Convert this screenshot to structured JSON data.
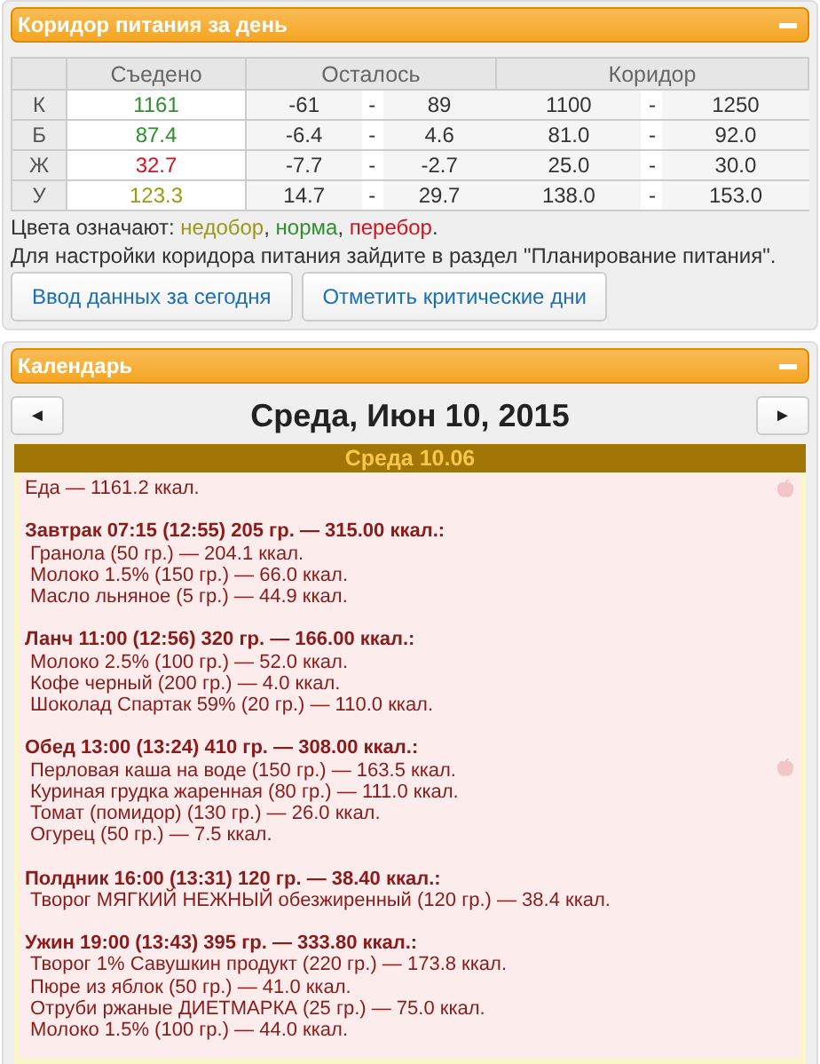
{
  "corridor_panel": {
    "title": "Коридор питания за день",
    "table": {
      "columns": [
        "Съедено",
        "Осталось",
        "Коридор"
      ],
      "rows": [
        {
          "label": "К",
          "eaten": "1161",
          "color": "#2f8f2f",
          "remaining": [
            "-61",
            "-",
            "89"
          ],
          "corridor": [
            "1100",
            "-",
            "1250"
          ]
        },
        {
          "label": "Б",
          "eaten": "87.4",
          "color": "#2f8f2f",
          "remaining": [
            "-6.4",
            "-",
            "4.6"
          ],
          "corridor": [
            "81.0",
            "-",
            "92.0"
          ]
        },
        {
          "label": "Ж",
          "eaten": "32.7",
          "color": "#d8121e",
          "remaining": [
            "-7.7",
            "-",
            "-2.7"
          ],
          "corridor": [
            "25.0",
            "-",
            "30.0"
          ]
        },
        {
          "label": "У",
          "eaten": "123.3",
          "color": "#9a9a16",
          "remaining": [
            "14.7",
            "-",
            "29.7"
          ],
          "corridor": [
            "138.0",
            "-",
            "153.0"
          ]
        }
      ]
    },
    "legend": [
      {
        "text": "Цвета означают: "
      },
      {
        "text": "недобор",
        "color": "#9a9a16"
      },
      {
        "text": ", "
      },
      {
        "text": "норма",
        "color": "#2f8f2f"
      },
      {
        "text": ", "
      },
      {
        "text": "перебор",
        "color": "#d8121e"
      },
      {
        "text": "."
      }
    ],
    "note": "Для настройки коридора питания зайдите в раздел \"Планирование питания\".",
    "buttons": [
      "Ввод данных за сегодня",
      "Отметить критические дни"
    ]
  },
  "calendar_panel": {
    "title": "Календарь",
    "prev": "◄",
    "next": "►",
    "date": "Среда, Июн 10, 2015",
    "day": {
      "title": "Среда 10.06",
      "total": "Еда — 1161.2 ккал.",
      "meals": [
        {
          "heading": "Завтрак 07:15 (12:55) 205 гр. — 315.00 ккал.:",
          "items": [
            "Гранола (50 гр.) — 204.1 ккал.",
            "Молоко 1.5% (150 гр.) — 66.0 ккал.",
            "Масло льняное (5 гр.) — 44.9 ккал."
          ]
        },
        {
          "heading": "Ланч 11:00 (12:56) 320 гр. — 166.00 ккал.:",
          "items": [
            "Молоко 2.5% (100 гр.) — 52.0 ккал.",
            "Кофе черный (200 гр.) — 4.0 ккал.",
            "Шоколад Спартак 59% (20 гр.) — 110.0 ккал."
          ]
        },
        {
          "heading": "Обед 13:00 (13:24) 410 гр. — 308.00 ккал.:",
          "items": [
            "Перловая каша на воде (150 гр.) — 163.5 ккал.",
            "Куриная грудка жаренная (80 гр.) — 111.0 ккал.",
            "Томат (помидор) (130 гр.) — 26.0 ккал.",
            "Огурец (50 гр.) — 7.5 ккал."
          ]
        },
        {
          "heading": "Полдник 16:00 (13:31) 120 гр. — 38.40 ккал.:",
          "items": [
            "Творог МЯГКИЙ НЕЖНЫЙ обезжиренный (120 гр.) — 38.4 ккал."
          ]
        },
        {
          "heading": "Ужин 19:00 (13:43) 395 гр. — 333.80 ккал.:",
          "items": [
            "Творог 1% Савушкин продукт (220 гр.) — 173.8 ккал.",
            "Пюре из яблок (50 гр.) — 41.0 ккал.",
            "Отруби ржаные ДИЕТМАРКА (25 гр.) — 75.0 ккал.",
            "Молоко 1.5% (100 гр.) — 44.0 ккал."
          ]
        }
      ]
    }
  }
}
